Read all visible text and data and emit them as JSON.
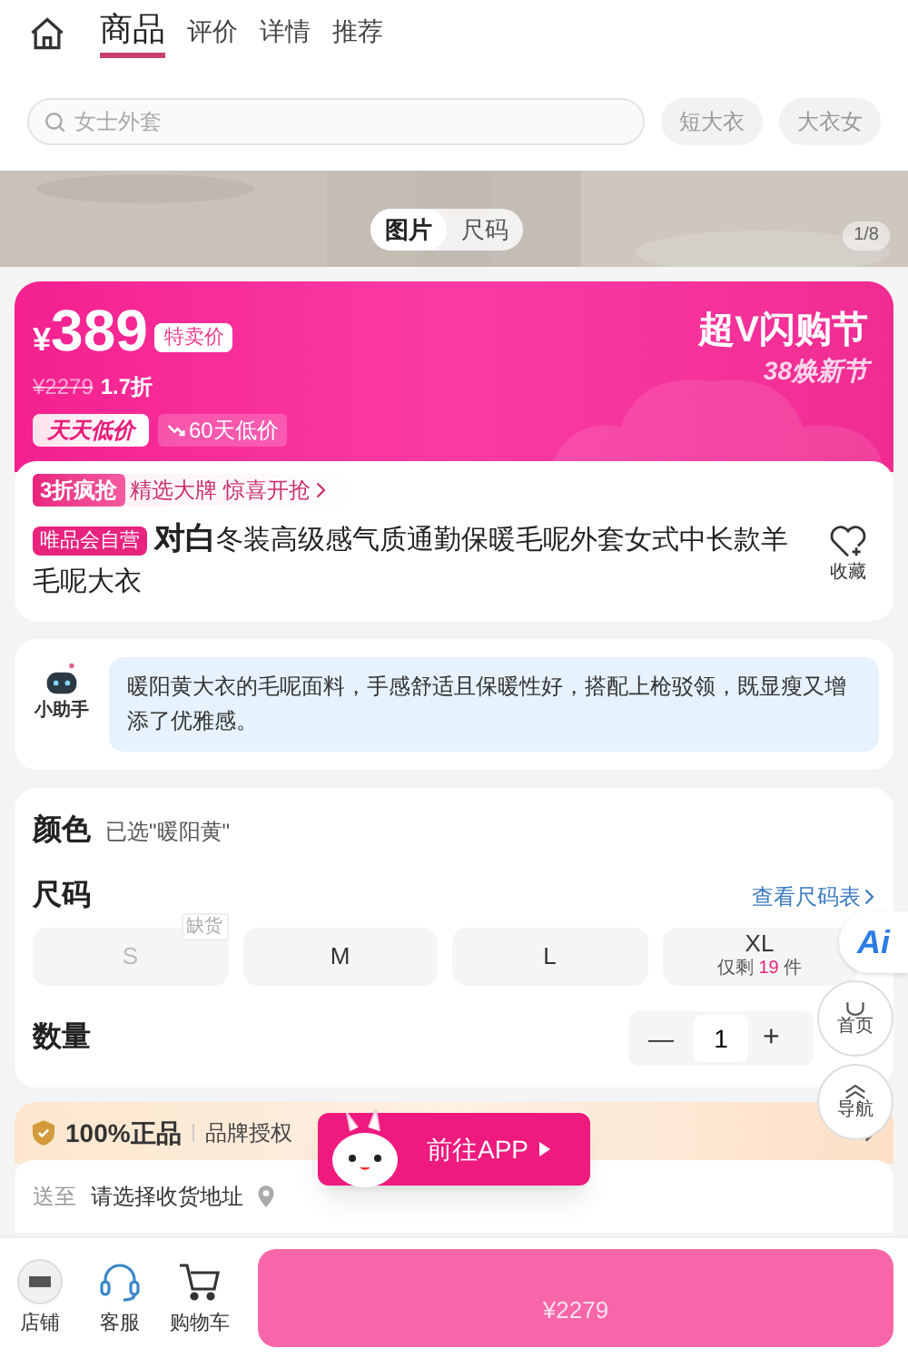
{
  "header": {
    "tabs": [
      {
        "label": "商品",
        "selected": true
      },
      {
        "label": "评价",
        "selected": false
      },
      {
        "label": "详情",
        "selected": false
      },
      {
        "label": "推荐",
        "selected": false
      }
    ]
  },
  "search": {
    "placeholder": "女士外套"
  },
  "suggestions": [
    "短大衣",
    "大衣女"
  ],
  "gallery": {
    "kind": "picture",
    "view_tabs": [
      {
        "label": "图片",
        "selected": true
      },
      {
        "label": "尺码",
        "selected": false
      }
    ],
    "counter": "1/8"
  },
  "price": {
    "currency": "¥",
    "amount": "389",
    "tag": "特卖价",
    "original": "¥2279",
    "discount": "1.7折",
    "badge": "天天低价",
    "history": "60天低价",
    "event_title": "超V闪购节",
    "event_subtitle": "38焕新节"
  },
  "promo": {
    "tag": "3折疯抢",
    "text": "精选大牌 惊喜开抢"
  },
  "product": {
    "badge": "唯品会自营",
    "title": "**对白**冬装高级感气质通勤保暖毛呢外套女式中长款羊毛呢大衣",
    "favorite": "收藏"
  },
  "assistant": {
    "name": "小助手",
    "text": "暖阳黄大衣的毛呢面料，手感舒适且保暖性好，搭配上枪驳领，既显瘦又增添了优雅感。"
  },
  "color": {
    "label": "颜色",
    "value": "已选\"暖阳黄\""
  },
  "size": {
    "label": "尺码",
    "link": "查看尺码表",
    "options": [
      {
        "label": "S",
        "available": false,
        "note": "缺货"
      },
      {
        "label": "M",
        "available": true
      },
      {
        "label": "L",
        "available": true
      },
      {
        "label": "XL",
        "available": true,
        "stock": {
          "prefix": "仅剩",
          "count": "19",
          "suffix": "件"
        }
      }
    ]
  },
  "quantity": {
    "label": "数量",
    "minus": "—",
    "value": "1",
    "plus": "+"
  },
  "guarantee": {
    "title": "100%正品",
    "text": "品牌授权"
  },
  "delivery": {
    "label": "送至",
    "value": "请选择收货地址"
  },
  "app_popup": {
    "label": "前往APP"
  },
  "floating": [
    {
      "kind": "ai",
      "label": "Ai"
    },
    {
      "kind": "home",
      "label": "首页"
    },
    {
      "kind": "nav",
      "label": "导航"
    }
  ],
  "bottom_bar": {
    "items": [
      {
        "kind": "store",
        "label": "店铺"
      },
      {
        "kind": "service",
        "label": "客服"
      },
      {
        "kind": "cart",
        "label": "购物车"
      }
    ],
    "buy_button": "¥2279"
  }
}
